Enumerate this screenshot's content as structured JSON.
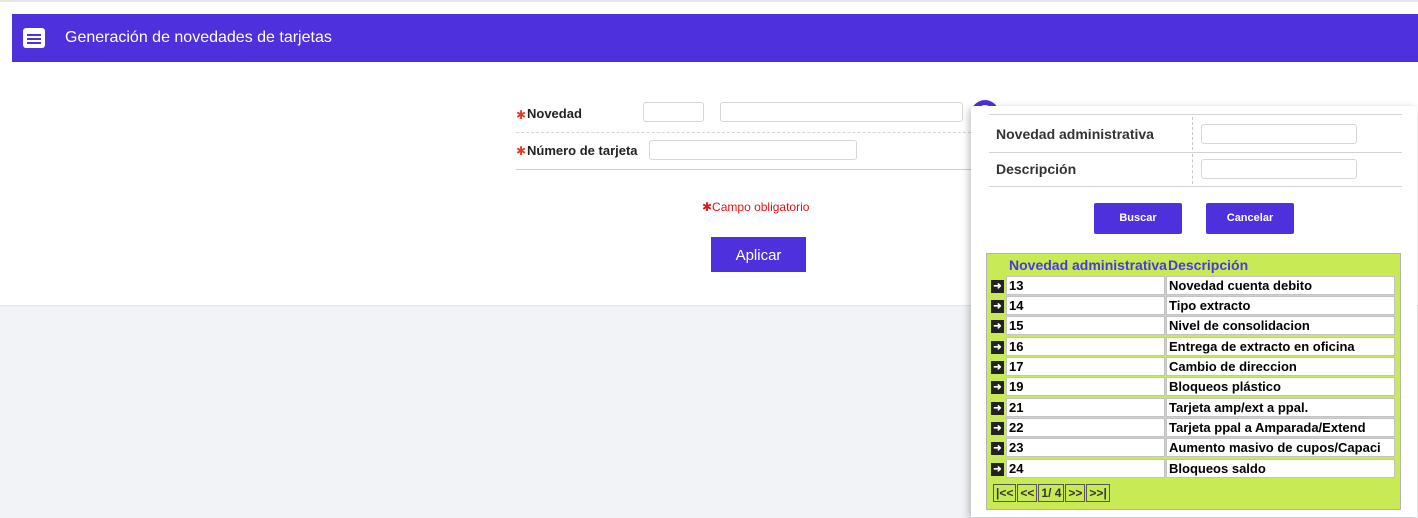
{
  "header": {
    "title": "Generación de novedades de tarjetas",
    "icon": "list-window-icon"
  },
  "form": {
    "required_mark": "✱",
    "novedad_label": "Novedad",
    "novedad_code_value": "",
    "novedad_desc_value": "",
    "tarjeta_label": "Número de tarjeta",
    "tarjeta_value": "",
    "required_note": "✱Campo obligatorio",
    "apply_label": "Aplicar"
  },
  "popup": {
    "filter_code_label": "Novedad administrativa",
    "filter_code_value": "",
    "filter_desc_label": "Descripción",
    "filter_desc_value": "",
    "search_label": "Buscar",
    "cancel_label": "Cancelar",
    "columns": [
      "Novedad administrativa",
      "Descripción"
    ],
    "rows": [
      {
        "code": "13",
        "desc": "Novedad cuenta debito"
      },
      {
        "code": "14",
        "desc": "Tipo extracto"
      },
      {
        "code": "15",
        "desc": "Nivel de consolidacion"
      },
      {
        "code": "16",
        "desc": "Entrega de extracto en oficina"
      },
      {
        "code": "17",
        "desc": "Cambio de direccion"
      },
      {
        "code": "19",
        "desc": "Bloqueos plástico"
      },
      {
        "code": "21",
        "desc": "Tarjeta amp/ext a ppal."
      },
      {
        "code": "22",
        "desc": "Tarjeta ppal a Amparada/Extend"
      },
      {
        "code": "23",
        "desc": "Aumento masivo de cupos/Capaci"
      },
      {
        "code": "24",
        "desc": "Bloqueos saldo"
      }
    ],
    "pager": {
      "first": "|<<",
      "prev": "<<",
      "page": "1/ 4",
      "next": ">>",
      "last": ">>|"
    }
  },
  "colors": {
    "accent": "#4e31dc",
    "grid_bg": "#c8eb55",
    "required": "#e53a1f"
  }
}
